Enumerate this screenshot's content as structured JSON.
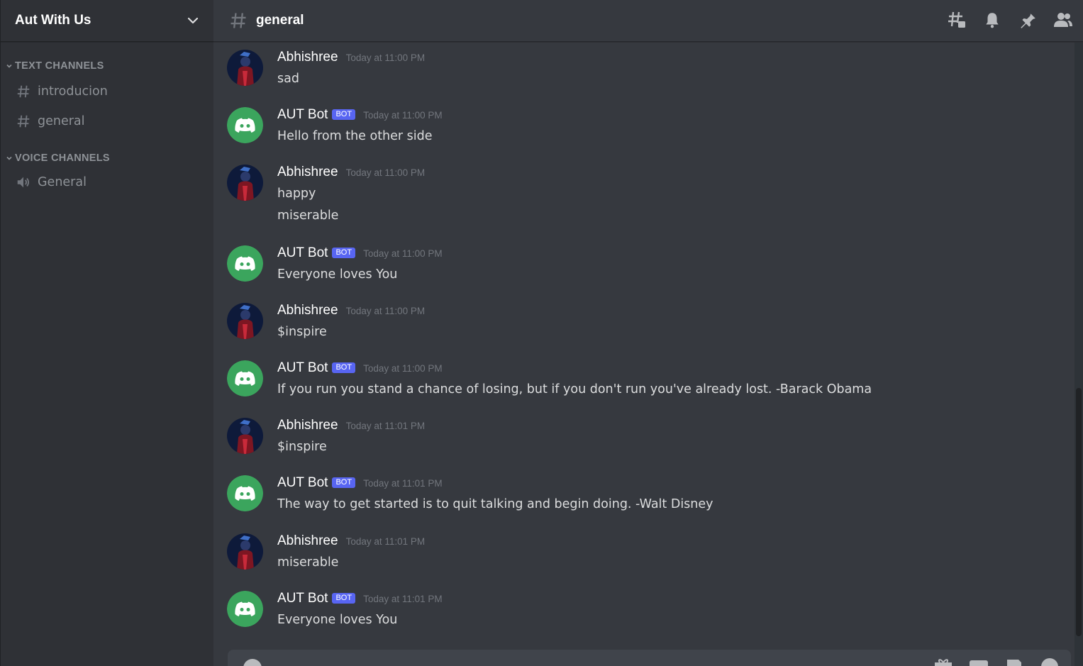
{
  "server": {
    "name": "Aut With Us"
  },
  "sidebar": {
    "categories": [
      {
        "label": "TEXT CHANNELS",
        "channels": [
          {
            "name": "introducion",
            "type": "text"
          },
          {
            "name": "general",
            "type": "text"
          }
        ]
      },
      {
        "label": "VOICE CHANNELS",
        "channels": [
          {
            "name": "General",
            "type": "voice"
          }
        ]
      }
    ]
  },
  "header": {
    "channel": "general",
    "tools": [
      "threads-icon",
      "notification-bell-icon",
      "pin-icon",
      "member-list-icon"
    ]
  },
  "messages": [
    {
      "author": "Abhishree",
      "bot": false,
      "timestamp": "Today at 11:00 PM",
      "lines": [
        "sad"
      ]
    },
    {
      "author": "AUT Bot",
      "bot": true,
      "timestamp": "Today at 11:00 PM",
      "lines": [
        "Hello from the other side"
      ]
    },
    {
      "author": "Abhishree",
      "bot": false,
      "timestamp": "Today at 11:00 PM",
      "lines": [
        "happy",
        "miserable"
      ]
    },
    {
      "author": "AUT Bot",
      "bot": true,
      "timestamp": "Today at 11:00 PM",
      "lines": [
        "Everyone loves You"
      ]
    },
    {
      "author": "Abhishree",
      "bot": false,
      "timestamp": "Today at 11:00 PM",
      "lines": [
        "$inspire"
      ]
    },
    {
      "author": "AUT Bot",
      "bot": true,
      "timestamp": "Today at 11:00 PM",
      "lines": [
        "If you run you stand a chance of losing, but if you don't run you've already lost. -Barack Obama"
      ]
    },
    {
      "author": "Abhishree",
      "bot": false,
      "timestamp": "Today at 11:01 PM",
      "lines": [
        "$inspire"
      ]
    },
    {
      "author": "AUT Bot",
      "bot": true,
      "timestamp": "Today at 11:01 PM",
      "lines": [
        "The way to get started is to quit talking and begin doing. -Walt Disney"
      ]
    },
    {
      "author": "Abhishree",
      "bot": false,
      "timestamp": "Today at 11:01 PM",
      "lines": [
        "miserable"
      ]
    },
    {
      "author": "AUT Bot",
      "bot": true,
      "timestamp": "Today at 11:01 PM",
      "lines": [
        "Everyone loves You"
      ]
    }
  ],
  "bot_tag_label": "BOT",
  "composer": {
    "placeholder": "",
    "tools": [
      "gift-icon",
      "gif-icon",
      "sticker-icon",
      "emoji-icon"
    ]
  },
  "colors": {
    "accent": "#5865f2",
    "bot_avatar": "#3ba55d",
    "bg": "#36393f",
    "sidebar": "#2f3136"
  }
}
